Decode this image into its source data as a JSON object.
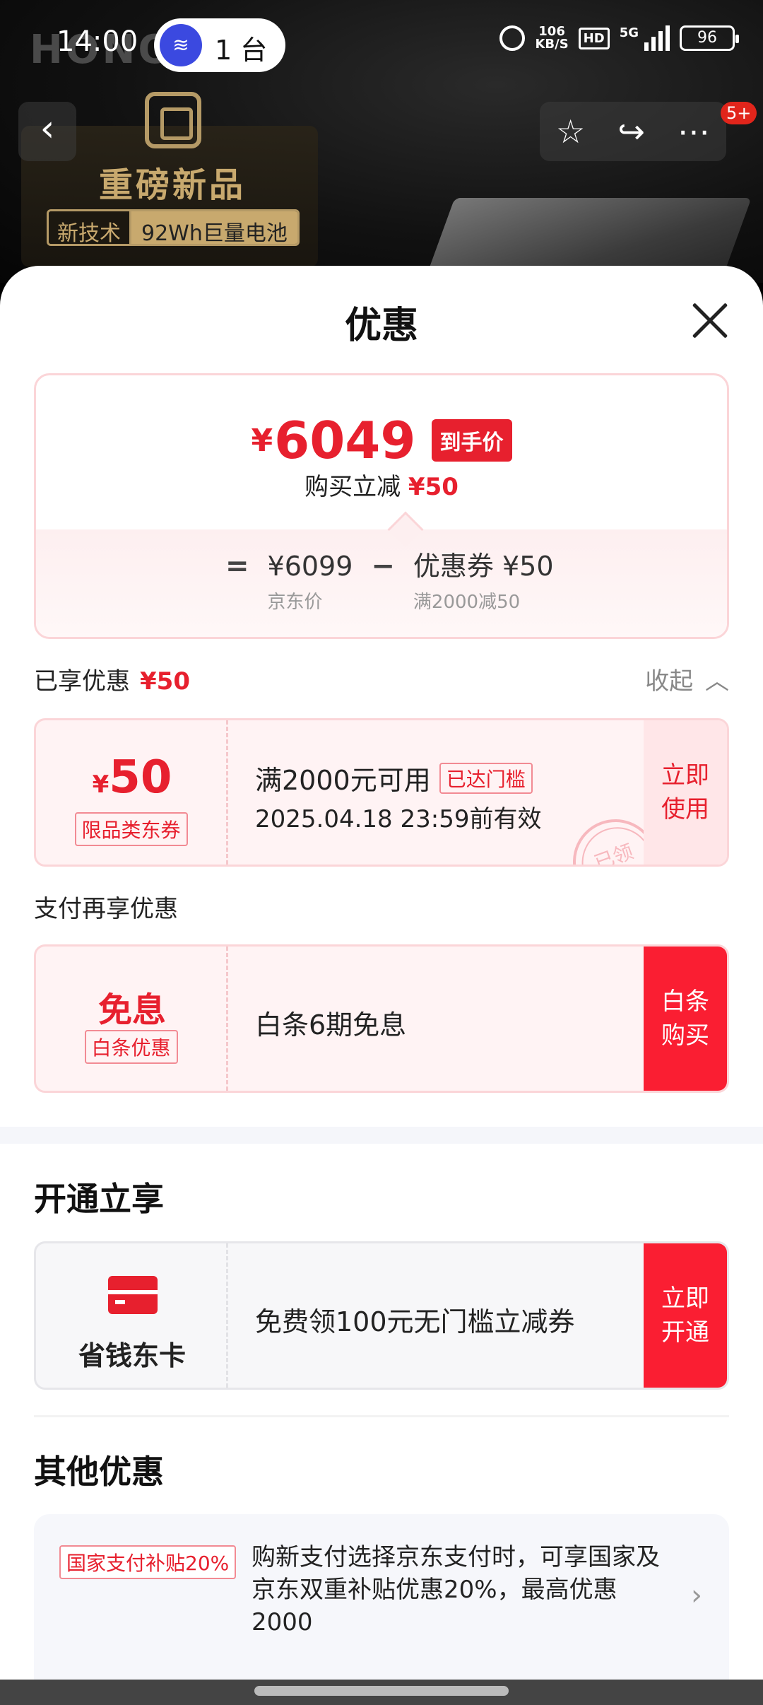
{
  "status_bar": {
    "time": "14:00",
    "hotspot_count": "1 台",
    "net_speed_value": "106",
    "net_speed_unit": "KB/S",
    "hd": "HD",
    "network": "5G",
    "battery": "96"
  },
  "hero": {
    "brand": "HONOR",
    "title": "重磅新品",
    "tag_a": "新技术",
    "tag_b": "92Wh巨量电池",
    "more_badge": "5+"
  },
  "sheet": {
    "title": "优惠"
  },
  "price": {
    "currency": "¥",
    "final": "6049",
    "final_tag": "到手价",
    "sub_label": "购买立减",
    "sub_value": "¥50",
    "eq": "=",
    "jd_price": "¥6099",
    "jd_price_label": "京东价",
    "minus": "−",
    "coupon_value": "优惠券 ¥50",
    "coupon_desc": "满2000减50"
  },
  "enjoyed": {
    "label": "已享优惠",
    "value": "¥50",
    "collapse": "收起"
  },
  "coupon1": {
    "currency": "¥",
    "amount": "50",
    "type": "限品类东券",
    "condition": "满2000元可用",
    "reached": "已达门槛",
    "expiry": "2025.04.18 23:59前有效",
    "action_line1": "立即",
    "action_line2": "使用",
    "stamp": "已领"
  },
  "pay_section": {
    "label": "支付再享优惠",
    "title": "免息",
    "tag": "白条优惠",
    "desc": "白条6期免息",
    "action_line1": "白条",
    "action_line2": "购买"
  },
  "open_section": {
    "heading": "开通立享",
    "name": "省钱东卡",
    "desc": "免费领100元无门槛立减券",
    "action_line1": "立即",
    "action_line2": "开通"
  },
  "other_section": {
    "heading": "其他优惠",
    "tag": "国家支付补贴20%",
    "text": "购新支付选择京东支付时，可享国家及京东双重补贴优惠20%，最高优惠2000"
  },
  "colors": {
    "accent": "#e7202e",
    "accent_light": "#fff3f4",
    "border": "#fbd5d8"
  }
}
